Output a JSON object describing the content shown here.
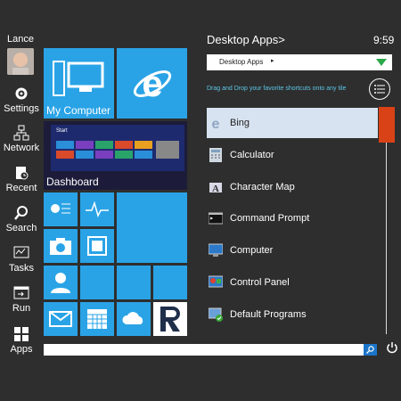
{
  "user": {
    "name": "Lance"
  },
  "sidebar": {
    "items": [
      {
        "label": "Settings",
        "icon": "gear-icon"
      },
      {
        "label": "Network",
        "icon": "network-icon"
      },
      {
        "label": "Recent",
        "icon": "recent-icon"
      },
      {
        "label": "Search",
        "icon": "search-icon"
      },
      {
        "label": "Tasks",
        "icon": "tasks-icon"
      },
      {
        "label": "Run",
        "icon": "run-icon"
      },
      {
        "label": "Apps",
        "icon": "apps-icon"
      }
    ]
  },
  "tiles": {
    "my_computer": "My Computer",
    "dashboard": "Dashboard",
    "start_preview_label": "Start"
  },
  "panel": {
    "title": "Desktop Apps>",
    "clock": "9:59",
    "dropdown_value": "Desktop Apps",
    "hint": "Drag and Drop your favorite shortcuts onto any tile",
    "apps": [
      {
        "label": "Bing",
        "icon": "bing-icon"
      },
      {
        "label": "Calculator",
        "icon": "calculator-icon"
      },
      {
        "label": "Character Map",
        "icon": "character-map-icon"
      },
      {
        "label": "Command Prompt",
        "icon": "command-prompt-icon"
      },
      {
        "label": "Computer",
        "icon": "computer-icon"
      },
      {
        "label": "Control Panel",
        "icon": "control-panel-icon"
      },
      {
        "label": "Default Programs",
        "icon": "default-programs-icon"
      }
    ]
  },
  "search": {
    "placeholder": ""
  },
  "colors": {
    "tile_blue": "#2aa3e6",
    "accent_orange": "#d84216",
    "dropdown_arrow": "#2ba84a",
    "selection": "#d8e3f1"
  }
}
